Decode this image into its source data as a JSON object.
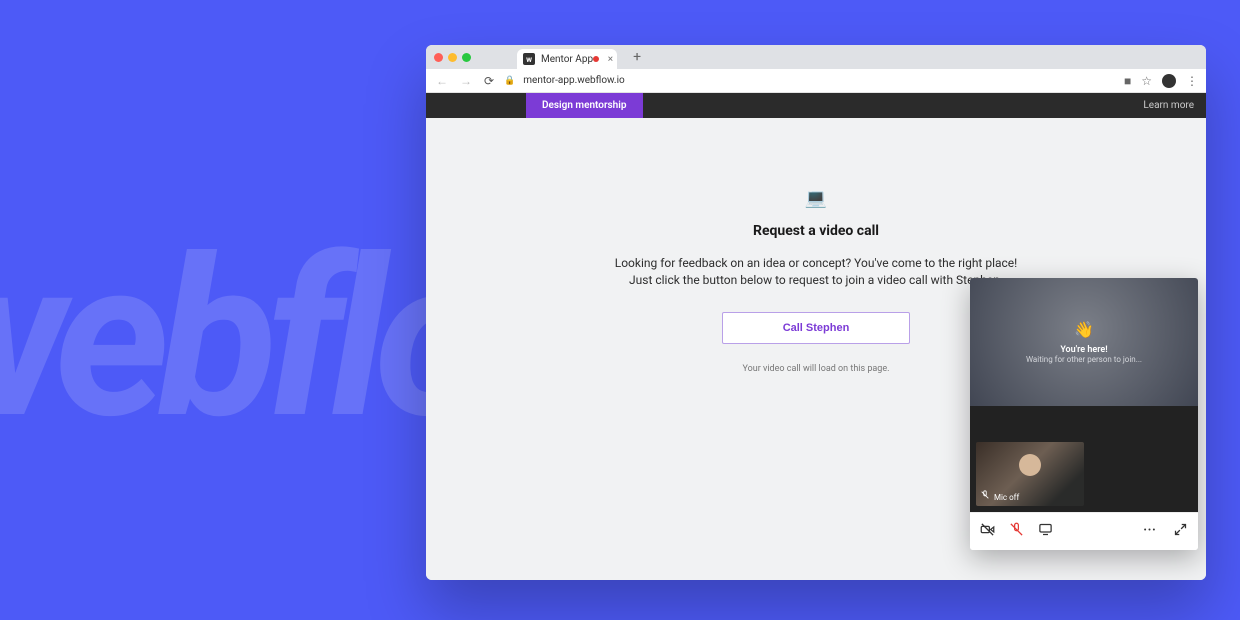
{
  "background": {
    "wordmark": "webflow"
  },
  "browser": {
    "tab": {
      "title": "Mentor App"
    },
    "url": "mentor-app.webflow.io"
  },
  "site_header": {
    "pill": "Design mentorship",
    "learn_more": "Learn more"
  },
  "main": {
    "icon": "💻",
    "title": "Request a video call",
    "desc_line1": "Looking for feedback on an idea or concept? You've come to the right place!",
    "desc_line2": "Just click the button below to request to join a video call with Stephen.",
    "cta": "Call Stephen",
    "subnote": "Your video call will load on this page."
  },
  "video": {
    "wave": "👋",
    "here": "You're here!",
    "waiting": "Waiting for other person to join...",
    "mic_label": "Mic off"
  }
}
